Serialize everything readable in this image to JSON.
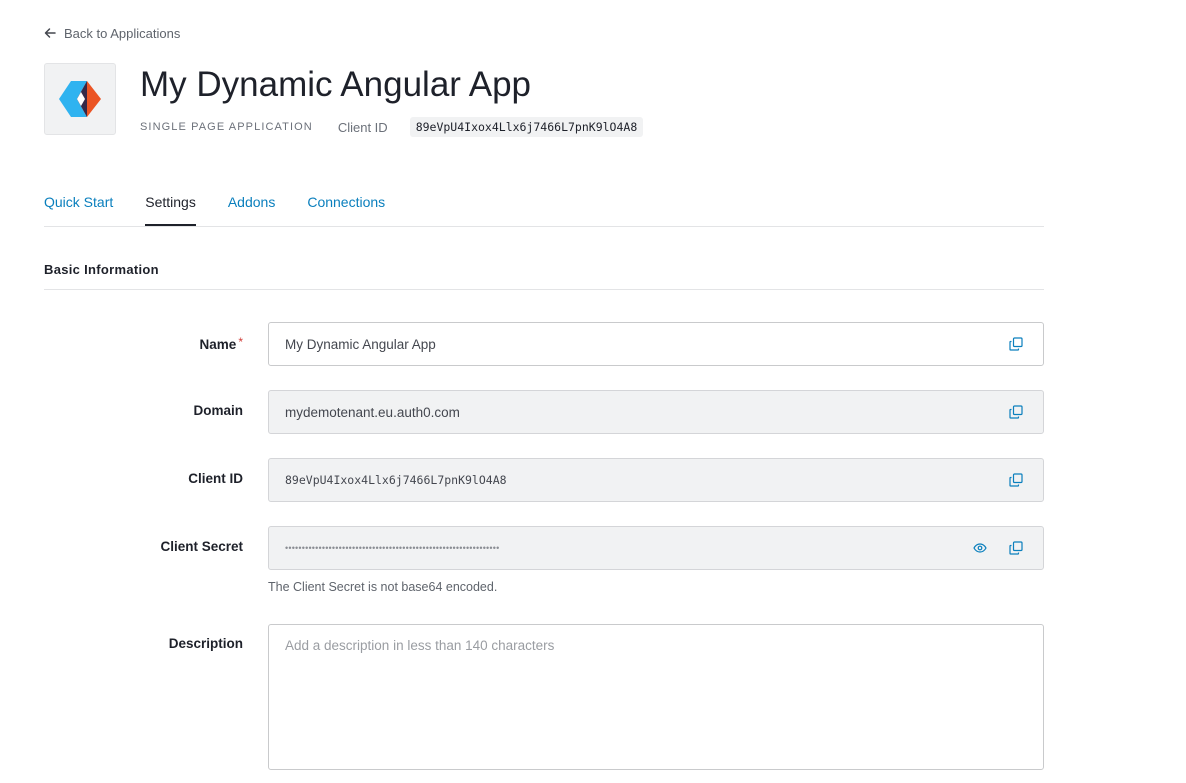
{
  "nav": {
    "back_label": "Back to Applications"
  },
  "app": {
    "title": "My Dynamic Angular App",
    "type": "SINGLE PAGE APPLICATION",
    "client_id_label": "Client ID",
    "client_id": "89eVpU4Ixox4Llx6j7466L7pnK9lO4A8"
  },
  "tabs": [
    {
      "label": "Quick Start",
      "active": false
    },
    {
      "label": "Settings",
      "active": true
    },
    {
      "label": "Addons",
      "active": false
    },
    {
      "label": "Connections",
      "active": false
    }
  ],
  "section": {
    "heading": "Basic Information"
  },
  "fields": {
    "name": {
      "label": "Name",
      "required_mark": "*",
      "value": "My Dynamic Angular App"
    },
    "domain": {
      "label": "Domain",
      "value": "mydemotenant.eu.auth0.com"
    },
    "client_id": {
      "label": "Client ID",
      "value": "89eVpU4Ixox4Llx6j7466L7pnK9lO4A8"
    },
    "client_secret": {
      "label": "Client Secret",
      "value": "••••••••••••••••••••••••••••••••••••••••••••••••••••••••••••••••",
      "helper": "The Client Secret is not base64 encoded."
    },
    "description": {
      "label": "Description",
      "placeholder": "Add a description in less than 140 characters"
    }
  },
  "icons": {
    "back": "arrow-left-icon",
    "copy": "copy-icon",
    "reveal": "eye-icon"
  },
  "colors": {
    "link": "#0a7fbd",
    "required": "#d03c38",
    "logo_blue": "#2fb3f0",
    "logo_orange": "#eb5424",
    "logo_navy": "#16214d"
  }
}
